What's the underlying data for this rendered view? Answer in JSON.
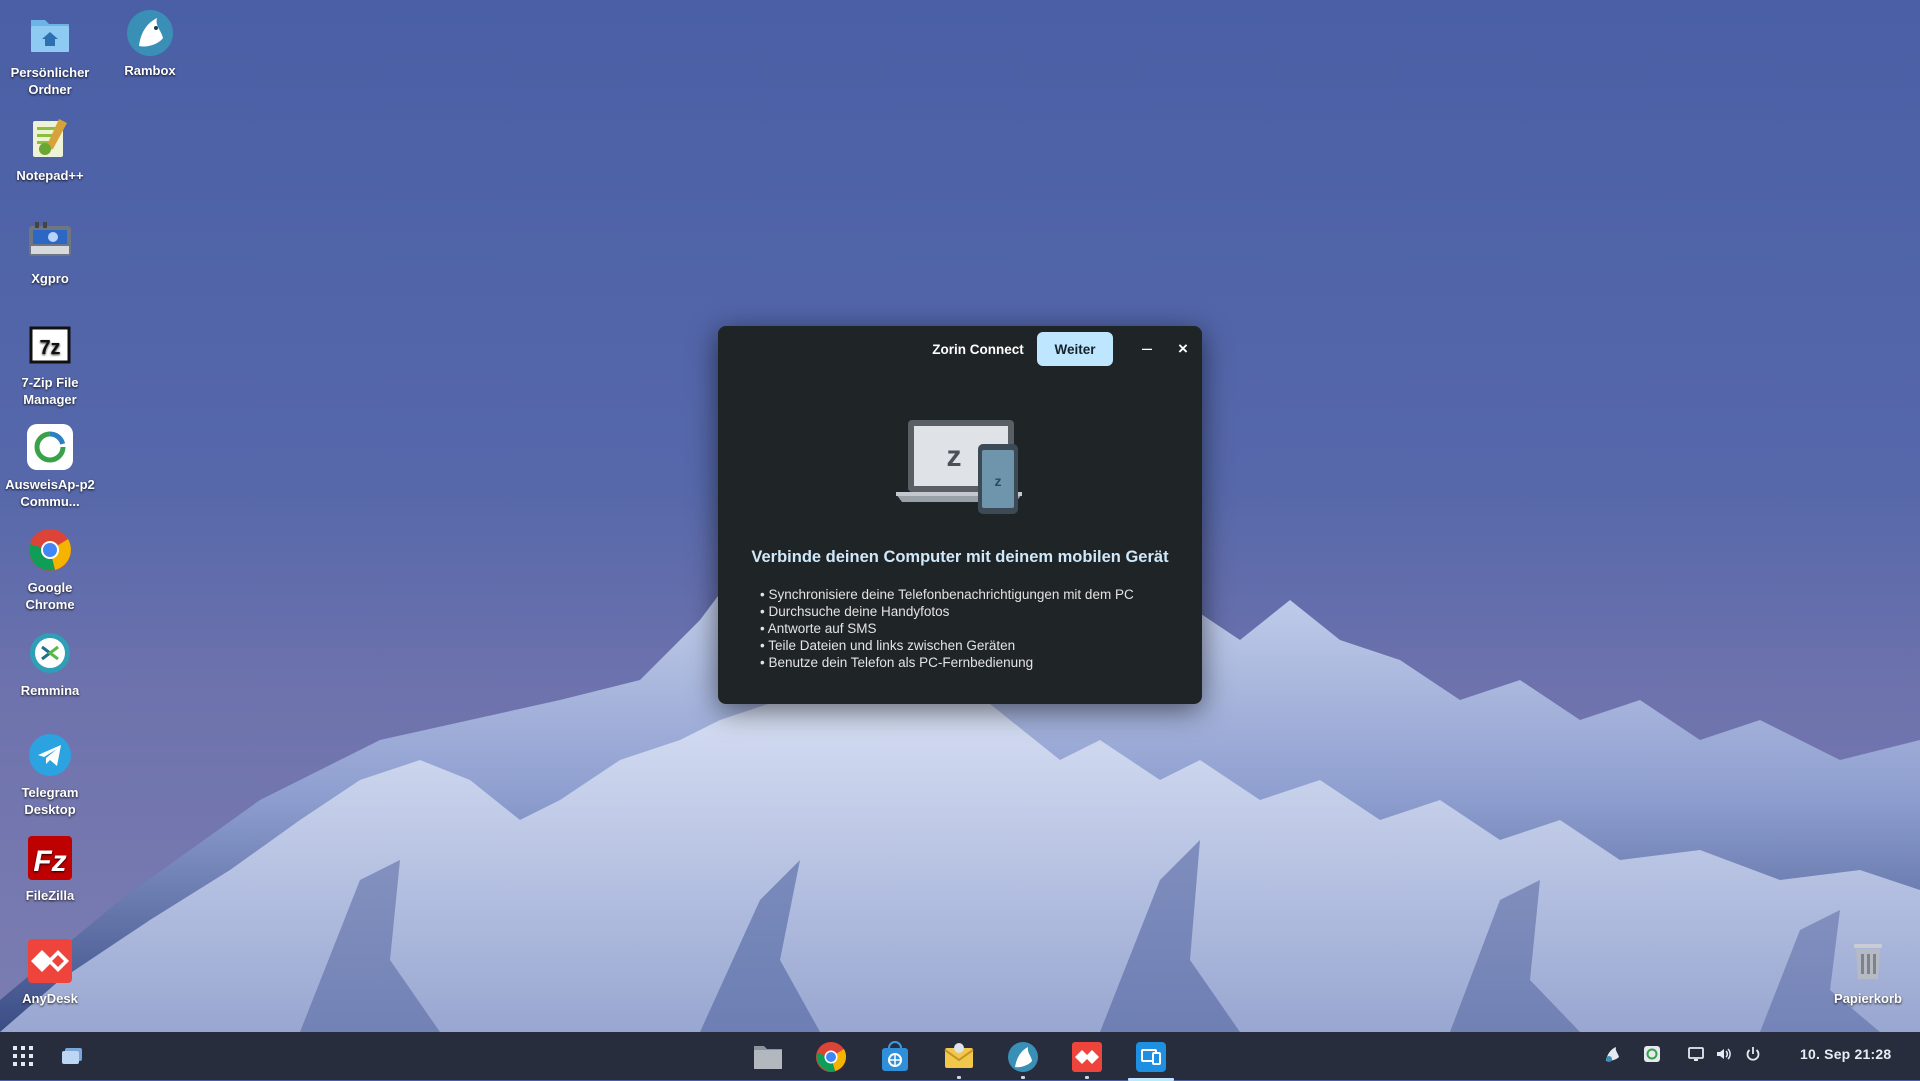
{
  "desktop_icons": [
    {
      "label": "Persönlicher Ordner",
      "icon": "home-folder-icon"
    },
    {
      "label": "Rambox",
      "icon": "rambox-icon"
    },
    {
      "label": "Notepad++",
      "icon": "notepad-plus-plus-icon"
    },
    {
      "label": "Xgpro",
      "icon": "xgpro-icon"
    },
    {
      "label": "7-Zip File Manager",
      "icon": "seven-zip-icon"
    },
    {
      "label": "AusweisAp-p2 Commu...",
      "icon": "ausweisapp-icon"
    },
    {
      "label": "Google Chrome",
      "icon": "chrome-icon"
    },
    {
      "label": "Remmina",
      "icon": "remmina-icon"
    },
    {
      "label": "Telegram Desktop",
      "icon": "telegram-icon"
    },
    {
      "label": "FileZilla",
      "icon": "filezilla-icon"
    },
    {
      "label": "AnyDesk",
      "icon": "anydesk-icon"
    },
    {
      "label": "Papierkorb",
      "icon": "trash-icon"
    }
  ],
  "dialog": {
    "title": "Zorin Connect",
    "next_button": "Weiter",
    "minimize_glyph": "–",
    "close_glyph": "×",
    "heading": "Verbinde deinen Computer mit deinem mobilen Gerät",
    "features": [
      "Synchronisiere deine Telefonbenachrichtigungen mit dem PC",
      "Durchsuche deine Handyfotos",
      "Antworte auf SMS",
      "Teile Dateien und links zwischen Geräten",
      "Benutze dein Telefon als PC-Fernbedienung"
    ],
    "illustration": "laptop-phone-icon"
  },
  "taskbar": {
    "apps": [
      {
        "icon": "files-icon",
        "running": false
      },
      {
        "icon": "chrome-icon",
        "running": false
      },
      {
        "icon": "software-store-icon",
        "running": false
      },
      {
        "icon": "mail-icon",
        "running": true
      },
      {
        "icon": "rambox-icon",
        "running": true
      },
      {
        "icon": "anydesk-icon",
        "running": true
      },
      {
        "icon": "zorin-connect-icon",
        "running": true,
        "active": true
      }
    ],
    "tray": [
      "rambox-tray-icon",
      "ausweisapp-tray-icon",
      "display-icon",
      "volume-icon",
      "power-icon"
    ],
    "clock": "10. Sep  21:28"
  },
  "colors": {
    "accent": "#bfe6ff",
    "dialog_bg": "#1f2426",
    "taskbar_bg": "#222834"
  }
}
